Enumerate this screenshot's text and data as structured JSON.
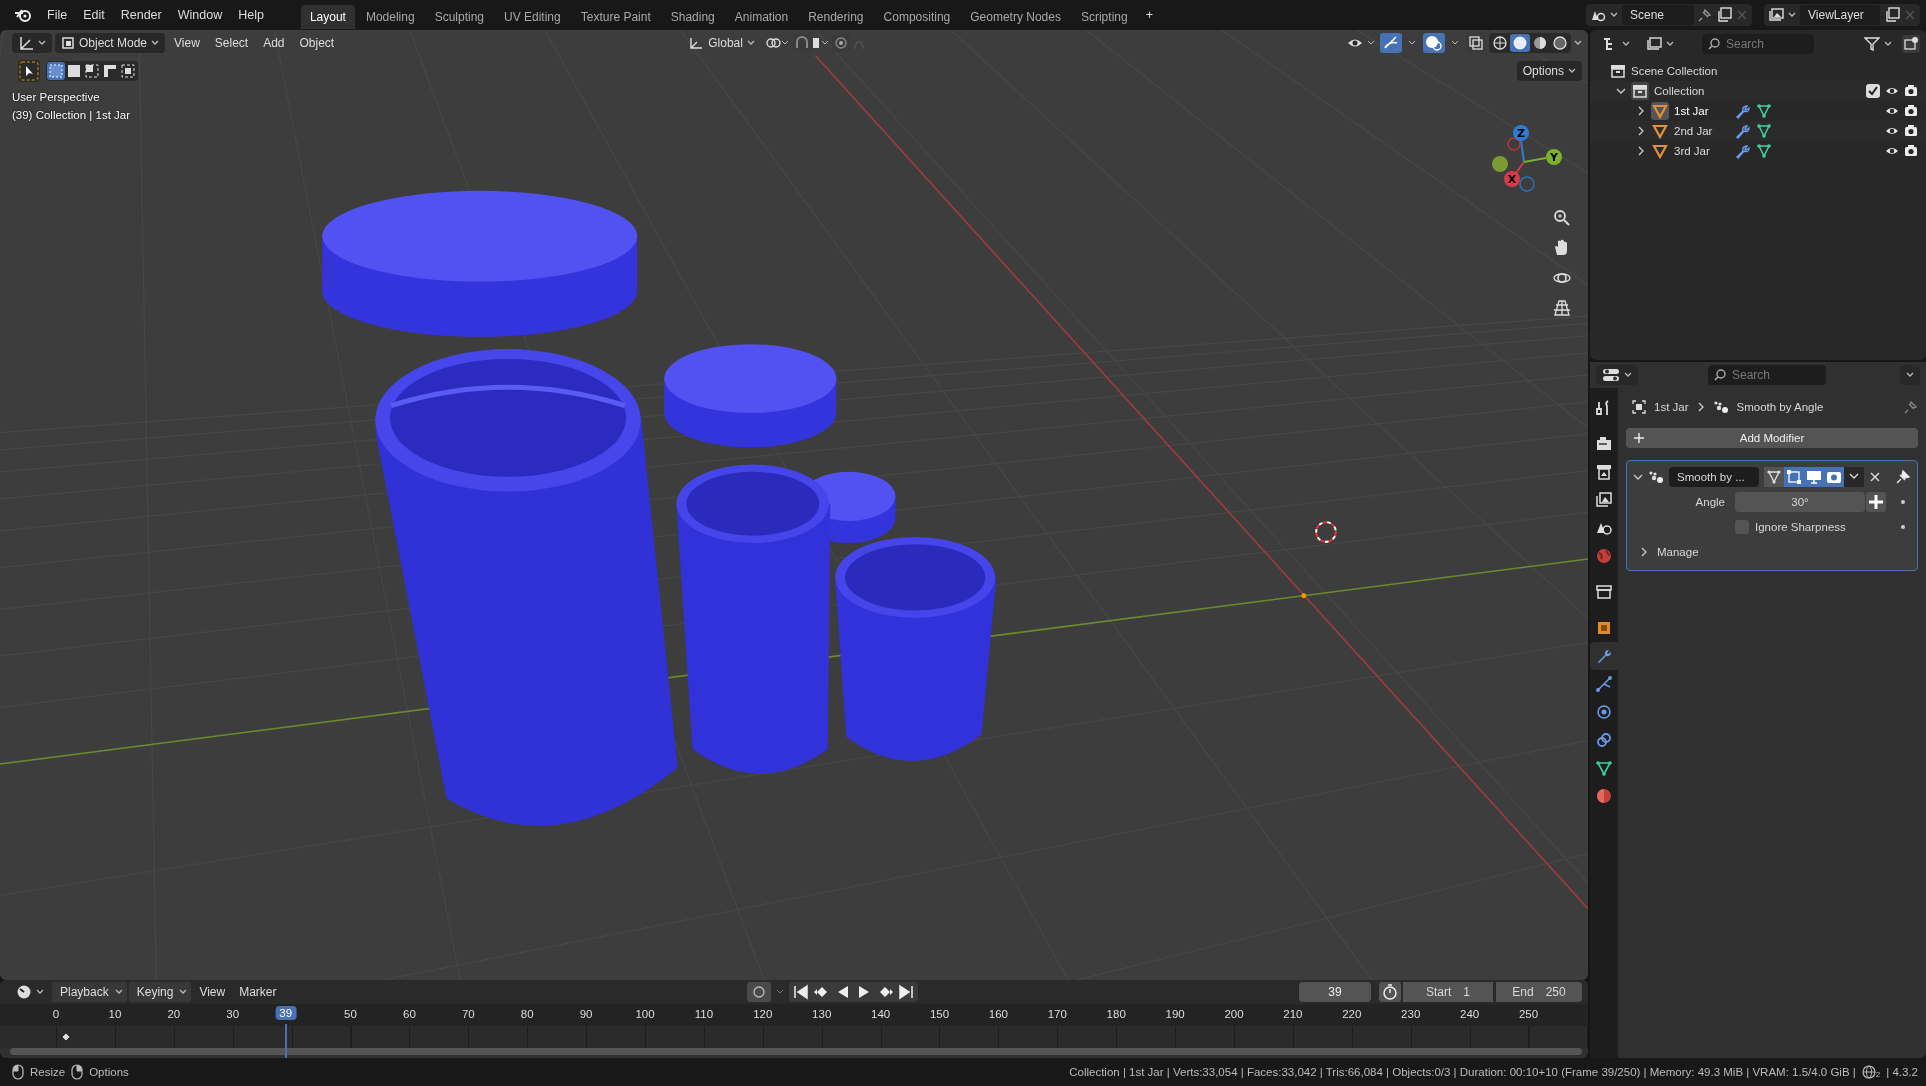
{
  "top_bar": {
    "menus": [
      "File",
      "Edit",
      "Render",
      "Window",
      "Help"
    ],
    "workspaces": [
      {
        "label": "Layout",
        "selected": true
      },
      {
        "label": "Modeling",
        "selected": false
      },
      {
        "label": "Sculpting",
        "selected": false
      },
      {
        "label": "UV Editing",
        "selected": false
      },
      {
        "label": "Texture Paint",
        "selected": false
      },
      {
        "label": "Shading",
        "selected": false
      },
      {
        "label": "Animation",
        "selected": false
      },
      {
        "label": "Rendering",
        "selected": false
      },
      {
        "label": "Compositing",
        "selected": false
      },
      {
        "label": "Geometry Nodes",
        "selected": false
      },
      {
        "label": "Scripting",
        "selected": false
      }
    ],
    "add_workspace": "+",
    "scene": "Scene",
    "view_layer": "ViewLayer"
  },
  "viewport": {
    "mode": "Object Mode",
    "menus": [
      "View",
      "Select",
      "Add",
      "Object"
    ],
    "orientation": "Global",
    "options": "Options",
    "select_modes": [
      {
        "selected": true
      },
      {
        "selected": false
      },
      {
        "selected": false
      },
      {
        "selected": false
      },
      {
        "selected": false
      }
    ],
    "gizmos_on": true,
    "overlays_on": true,
    "shading": [
      {
        "selected": false
      },
      {
        "selected": true
      },
      {
        "selected": false
      },
      {
        "selected": false
      }
    ],
    "info": [
      "User Perspective",
      "(39) Collection | 1st Jar"
    ],
    "gizmo_axes": [
      "Z",
      "Y",
      "X"
    ]
  },
  "outliner": {
    "search_placeholder": "Search",
    "root": {
      "label": "Scene Collection",
      "children": [
        {
          "label": "Collection",
          "expanded": true,
          "checked": true,
          "children": [
            {
              "label": "1st Jar",
              "selected": true,
              "expanded": false
            },
            {
              "label": "2nd Jar",
              "selected": false,
              "expanded": false
            },
            {
              "label": "3rd Jar",
              "selected": false,
              "expanded": false
            }
          ]
        }
      ]
    }
  },
  "properties": {
    "search_placeholder": "Search",
    "tabs": [
      {
        "kind": "tool",
        "selected": false
      },
      {
        "kind": "render",
        "selected": false
      },
      {
        "kind": "output",
        "selected": false
      },
      {
        "kind": "view_layer",
        "selected": false
      },
      {
        "kind": "scene",
        "selected": false
      },
      {
        "kind": "world",
        "selected": false
      },
      {
        "kind": "collection",
        "selected": false
      },
      {
        "kind": "object",
        "selected": false
      },
      {
        "kind": "modifiers",
        "selected": true
      },
      {
        "kind": "particles",
        "selected": false
      },
      {
        "kind": "physics",
        "selected": false
      },
      {
        "kind": "constraints",
        "selected": false
      },
      {
        "kind": "data",
        "selected": false
      },
      {
        "kind": "material",
        "selected": false
      }
    ],
    "breadcrumb": [
      "1st Jar",
      "Smooth by Angle"
    ],
    "add_modifier": "Add Modifier",
    "modifier": {
      "name": "Smooth by ...",
      "expanded": true,
      "edit_mode": true,
      "viewport": true,
      "render": true,
      "angle": {
        "label": "Angle",
        "value": "30°"
      },
      "ignore_sharpness": {
        "label": "Ignore Sharpness",
        "checked": false
      },
      "manage": {
        "label": "Manage",
        "expanded": false
      }
    }
  },
  "timeline": {
    "menus": [
      "Playback",
      "Keying",
      "View",
      "Marker"
    ],
    "current_frame": "39",
    "start": {
      "label": "Start",
      "value": "1"
    },
    "end": {
      "label": "End",
      "value": "250"
    },
    "ticks": [
      "0",
      "10",
      "20",
      "30",
      "50",
      "60",
      "70",
      "80",
      "90",
      "100",
      "110",
      "120",
      "130",
      "140",
      "150",
      "160",
      "170",
      "180",
      "190",
      "200",
      "210",
      "220",
      "230",
      "240",
      "250"
    ],
    "playhead": {
      "label": "39",
      "level": 0.156
    }
  },
  "status_bar": {
    "hints": [
      "Resize",
      "Options"
    ],
    "stats": "Collection | 1st Jar | Verts:33,054 | Faces:33,042 | Tris:66,084 | Objects:0/3 | Duration: 00:10+10 (Frame 39/250) | Memory: 49.3 MiB | VRAM: 1.5/4.0 GiB |",
    "network_badge": "2",
    "version": "| 4.3.2"
  }
}
